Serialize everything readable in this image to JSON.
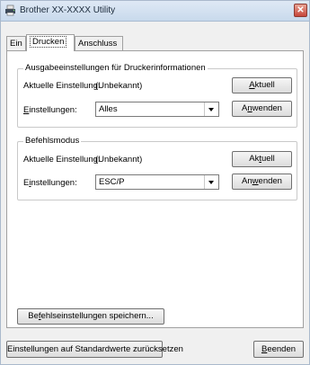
{
  "window": {
    "title": "Brother XX-XXXX Utility",
    "close_glyph": "✕"
  },
  "tabs": [
    {
      "label": "Ein",
      "active": false
    },
    {
      "label": "Drucken",
      "active": true
    },
    {
      "label": "Anschluss",
      "active": false
    }
  ],
  "output_group": {
    "title": "Ausgabeeinstellungen für Druckerinformationen",
    "current_label": "Aktuelle Einstellung:",
    "current_value": "(Unbekannt)",
    "current_button": {
      "prefix": "",
      "u": "A",
      "suffix": "ktuell"
    },
    "settings_label": {
      "prefix": "",
      "u": "E",
      "suffix": "instellungen:"
    },
    "settings_value": "Alles",
    "apply_button": {
      "prefix": "A",
      "u": "n",
      "suffix": "wenden"
    }
  },
  "command_group": {
    "title": "Befehlsmodus",
    "current_label": "Aktuelle Einstellung:",
    "current_value": "(Unbekannt)",
    "current_button": {
      "prefix": "Ak",
      "u": "t",
      "suffix": "uell"
    },
    "settings_label": {
      "prefix": "E",
      "u": "i",
      "suffix": "nstellungen:"
    },
    "settings_value": "ESC/P",
    "apply_button": {
      "prefix": "An",
      "u": "w",
      "suffix": "enden"
    }
  },
  "save_button": {
    "prefix": "Be",
    "u": "f",
    "suffix": "ehlseinstellungen speichern..."
  },
  "reset_button": "Einstellungen auf Standardwerte zurücksetzen",
  "exit_button": {
    "prefix": "",
    "u": "B",
    "suffix": "eenden"
  },
  "colors": {
    "titlebar": "#c8d9ec",
    "close": "#c6453a",
    "window_bg": "#f0f0f0"
  },
  "icons": [
    "printer-app-icon",
    "close-icon",
    "dropdown-arrow-icon"
  ]
}
